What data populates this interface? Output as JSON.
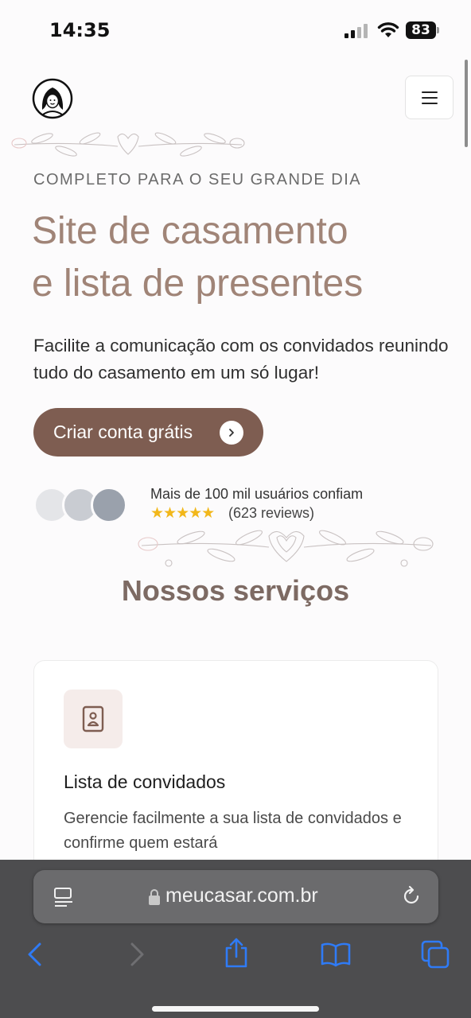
{
  "status_bar": {
    "time": "14:35",
    "battery": "83"
  },
  "header": {
    "logo_icon": "bride-avatar-icon",
    "menu_icon": "hamburger-icon"
  },
  "hero": {
    "eyebrow": "COMPLETO PARA O SEU GRANDE DIA",
    "title_line1": "Site de casamento",
    "title_line2": "e lista de presentes",
    "subtitle": "Facilite a comunicação com os convidados reunindo tudo do casamento em um só lugar!",
    "cta_label": "Criar conta grátis"
  },
  "social_proof": {
    "users_text": "Mais de 100 mil usuários confiam",
    "rating": 5,
    "stars": "★★★★★",
    "reviews": "(623 reviews)"
  },
  "services": {
    "title": "Nossos serviços",
    "cards": [
      {
        "icon": "contact-book-icon",
        "title": "Lista de convidados",
        "description": "Gerencie facilmente a sua lista de convidados e confirme quem estará"
      }
    ]
  },
  "browser": {
    "url": "meucasar.com.br"
  },
  "colors": {
    "accent": "#7e5d51",
    "title": "#a08477",
    "services_title": "#7d6a63",
    "star": "#f2b71a",
    "ios_blue": "#2f7bf6"
  }
}
